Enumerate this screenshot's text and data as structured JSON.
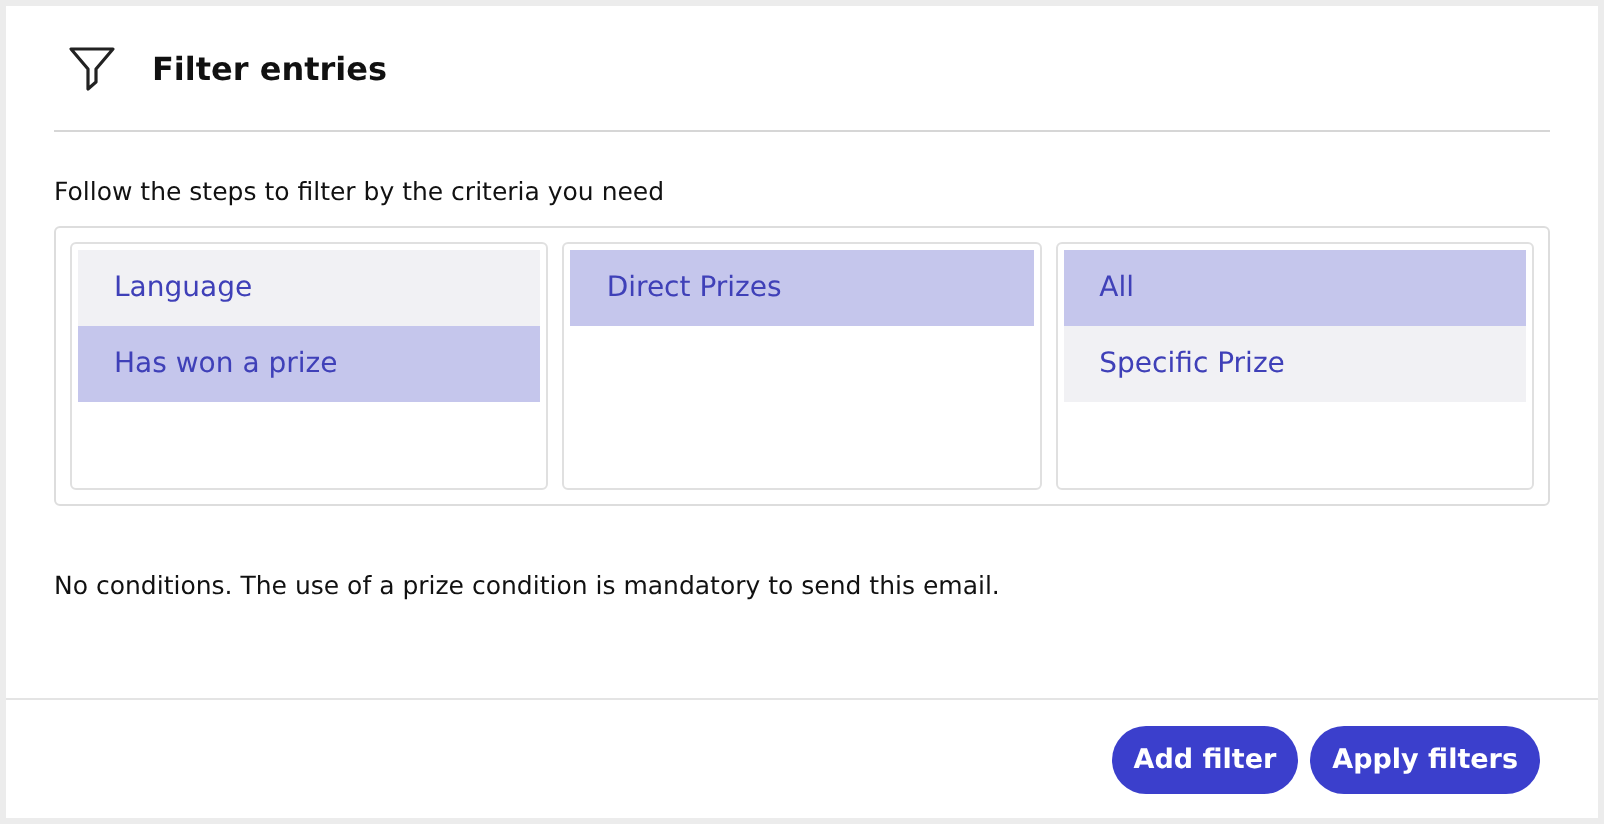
{
  "dialog": {
    "title": "Filter entries"
  },
  "instructions": "Follow the steps to filter by the criteria you need",
  "columns": [
    {
      "items": [
        {
          "label": "Language",
          "selected": false
        },
        {
          "label": "Has won a prize",
          "selected": true
        }
      ]
    },
    {
      "items": [
        {
          "label": "Direct Prizes",
          "selected": true
        }
      ]
    },
    {
      "items": [
        {
          "label": "All",
          "selected": true
        },
        {
          "label": "Specific Prize",
          "selected": false
        }
      ]
    }
  ],
  "note": "No conditions. The use of a prize condition is mandatory to send this email.",
  "buttons": [
    "Add filter",
    "Apply filters"
  ]
}
